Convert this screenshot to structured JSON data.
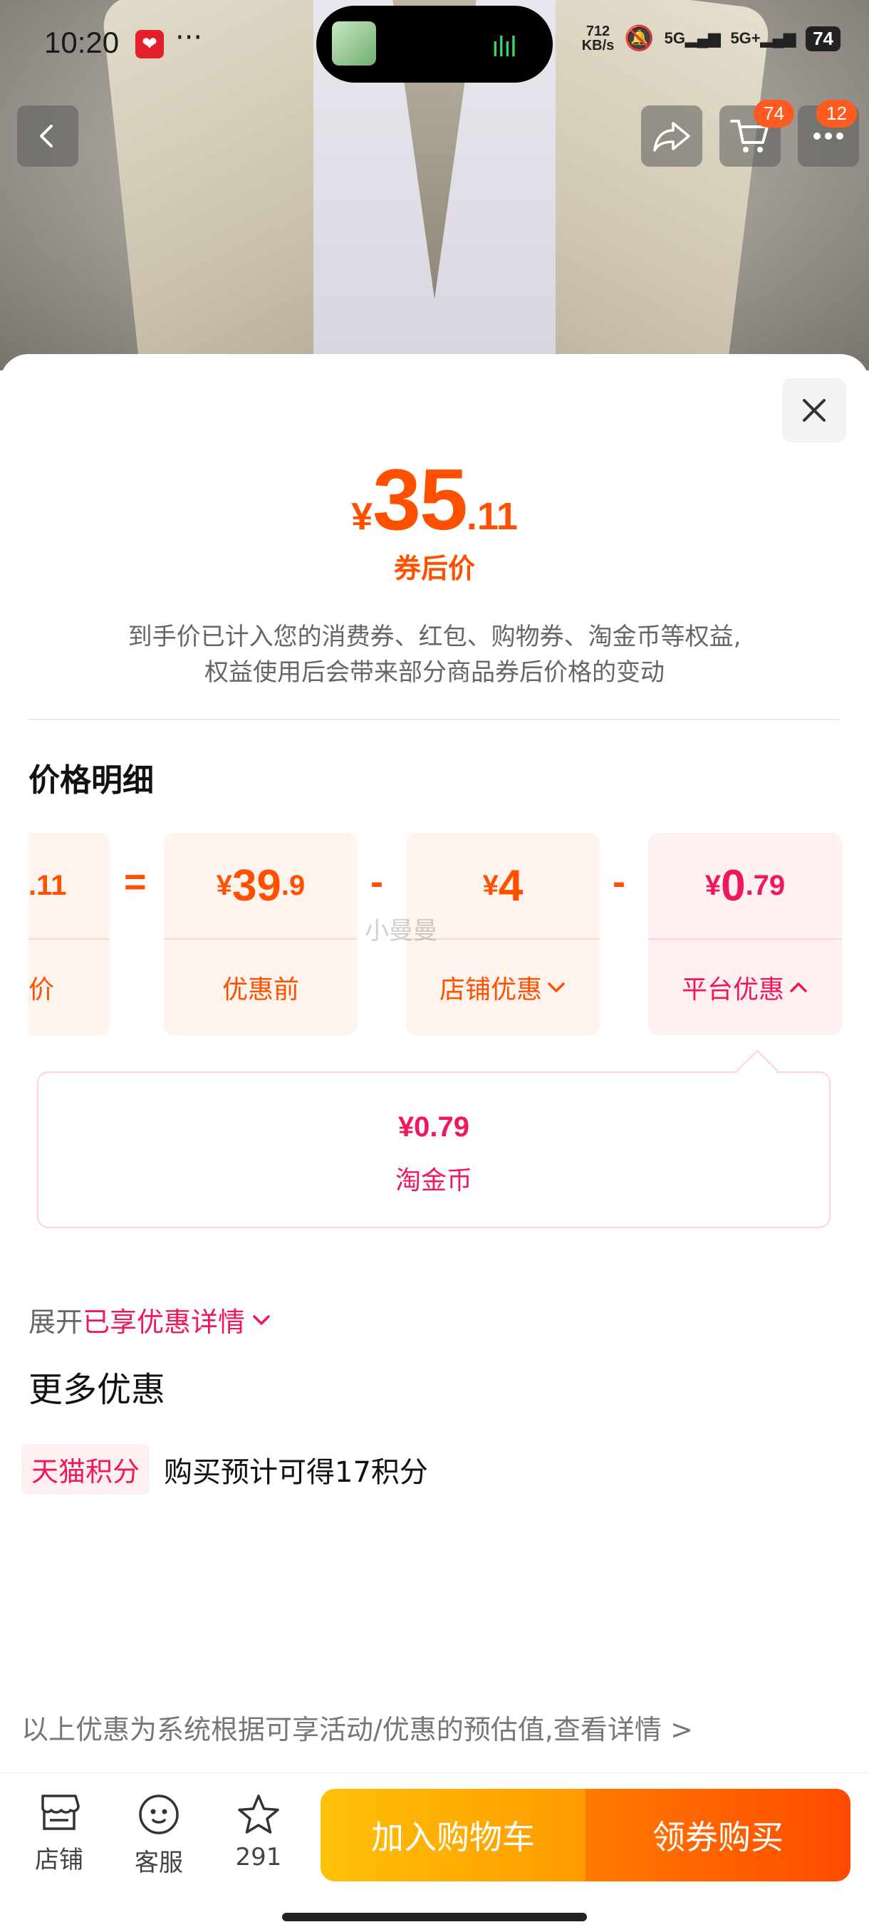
{
  "status_bar": {
    "time": "10:20",
    "dots": "···",
    "speed_top": "712",
    "speed_unit": "KB/s",
    "net1": "5G",
    "net2": "5G+",
    "battery": "74"
  },
  "top_buttons": {
    "cart_badge": "74",
    "message_badge": "12"
  },
  "sheet": {
    "price": {
      "currency": "¥",
      "integer": "35",
      "decimal": ".11"
    },
    "price_label": "券后价",
    "notice_line1": "到手价已计入您的消费券、红包、购物券、淘金币等权益,",
    "notice_line2": "权益使用后会带来部分商品券后价格的变动",
    "breakdown_title": "价格明细",
    "cards": [
      {
        "amount_int": "",
        "amount_dec": ".11",
        "label": "价"
      },
      {
        "currency": "¥",
        "amount_int": "39",
        "amount_dec": ".9",
        "label": "优惠前"
      },
      {
        "currency": "¥",
        "amount_int": "4",
        "amount_dec": "",
        "label": "店铺优惠"
      },
      {
        "currency": "¥",
        "amount_int": "0",
        "amount_dec": ".79",
        "label": "平台优惠"
      }
    ],
    "operators": [
      "=",
      "-",
      "-"
    ],
    "watermark": "小曼曼",
    "coin_detail": {
      "amount": "¥0.79",
      "name": "淘金币"
    },
    "expand_prefix": "展开",
    "expand_highlight": "已享优惠详情",
    "more_title": "更多优惠",
    "tmall_tag": "天猫积分",
    "tmall_text": "购买预计可得17积分",
    "footnote": "以上优惠为系统根据可享活动/优惠的预估值,查看详情 >"
  },
  "bottom_bar": {
    "shop_label": "店铺",
    "service_label": "客服",
    "favorite_count": "291",
    "add_cart_label": "加入购物车",
    "buy_label": "领券购买"
  },
  "colors": {
    "accent_orange": "#ff5000",
    "accent_pink": "#f0185a",
    "cart_gradient_start": "#ffc107",
    "buy_gradient_end": "#ff4a00"
  }
}
